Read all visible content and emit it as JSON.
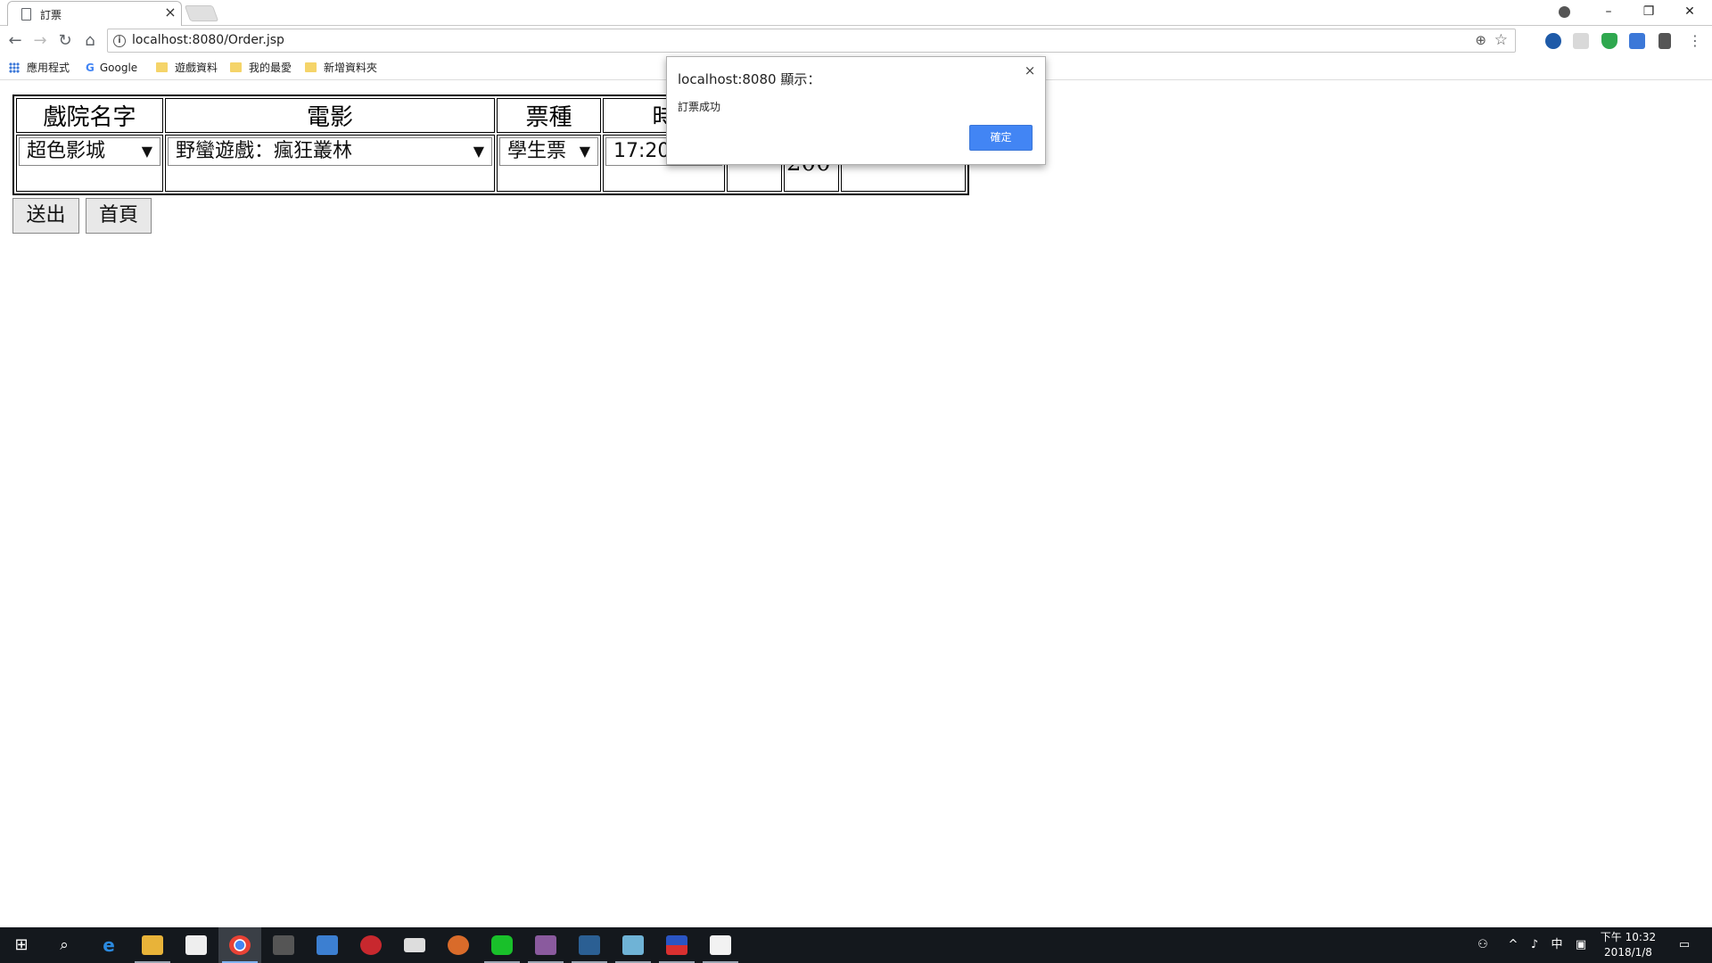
{
  "browser": {
    "tab_title": "訂票",
    "tab_close": "×",
    "url": "localhost:8080/Order.jsp",
    "window_controls": {
      "minimize": "–",
      "restore": "❐",
      "close": "✕"
    },
    "profile_icon": "person-circle-icon"
  },
  "bookmarks": [
    {
      "label": "應用程式",
      "icon": "apps-grid-icon"
    },
    {
      "label": "Google",
      "icon": "google-g-icon"
    },
    {
      "label": "遊戲資料",
      "icon": "folder-icon"
    },
    {
      "label": "我的最愛",
      "icon": "folder-icon"
    },
    {
      "label": "新增資料夾",
      "icon": "folder-icon"
    }
  ],
  "order_form": {
    "headers": [
      "戲院名字",
      "電影",
      "票種",
      "時"
    ],
    "cinema": "超色影城",
    "movie": "野蠻遊戲：瘋狂叢林",
    "ticket_type": "學生票",
    "time": "17:20",
    "price_partial": "200",
    "submit_label": "送出",
    "home_label": "首頁"
  },
  "alert": {
    "title": "localhost:8080 顯示：",
    "message": "訂票成功",
    "ok_label": "確定",
    "close": "×"
  },
  "taskbar": {
    "clock_time": "下午 10:32",
    "clock_date": "2018/1/8",
    "ime": "中",
    "apps": [
      "windows-start-icon",
      "search-icon",
      "edge-icon",
      "file-explorer-icon",
      "store-icon",
      "chrome-icon",
      "calculator-icon",
      "word-icon",
      "comic-app-icon",
      "mail-icon",
      "game-app-icon",
      "line-icon",
      "anime-app-icon",
      "visual-studio-icon",
      "notepad-icon",
      "flag-app-icon",
      "java-icon"
    ]
  },
  "colors": {
    "accent_blue": "#4285f4",
    "taskbar_bg": "#14181d",
    "folder_yellow": "#f5d469"
  }
}
